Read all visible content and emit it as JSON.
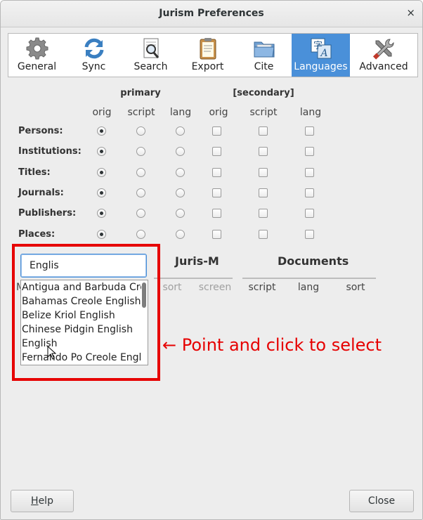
{
  "window": {
    "title": "Jurism Preferences",
    "close_glyph": "×"
  },
  "toolbar": {
    "tabs": [
      {
        "label": "General",
        "icon": "gear-icon",
        "selected": false
      },
      {
        "label": "Sync",
        "icon": "sync-icon",
        "selected": false
      },
      {
        "label": "Search",
        "icon": "search-icon",
        "selected": false
      },
      {
        "label": "Export",
        "icon": "clipboard-icon",
        "selected": false
      },
      {
        "label": "Cite",
        "icon": "folder-icon",
        "selected": false
      },
      {
        "label": "Languages",
        "icon": "translate-icon",
        "selected": true
      },
      {
        "label": "Advanced",
        "icon": "tools-icon",
        "selected": false
      }
    ],
    "translate_glyph_top": "字",
    "translate_glyph_bottom": "A"
  },
  "matrix": {
    "primary_label": "primary",
    "secondary_label": "[secondary]",
    "primary_cols": [
      "orig",
      "script",
      "lang"
    ],
    "secondary_cols": [
      "orig",
      "script",
      "lang"
    ],
    "rows": [
      {
        "label": "Persons:",
        "selected_primary": "orig"
      },
      {
        "label": "Institutions:",
        "selected_primary": "orig"
      },
      {
        "label": "Titles:",
        "selected_primary": "orig"
      },
      {
        "label": "Journals:",
        "selected_primary": "orig"
      },
      {
        "label": "Publishers:",
        "selected_primary": "orig"
      },
      {
        "label": "Places:",
        "selected_primary": "orig"
      }
    ]
  },
  "lang_section": {
    "jurism_title": "Juris-M",
    "documents_title": "Documents",
    "jurism_cols": [
      "sort",
      "screen"
    ],
    "documents_cols": [
      "script",
      "lang",
      "sort"
    ],
    "hidden_left_initial": "M"
  },
  "search": {
    "value": "Englis",
    "suggestions": [
      "Antigua and Barbuda Creole English",
      "Bahamas Creole English",
      "Belize Kriol English",
      "Chinese Pidgin English",
      "English",
      "Fernando Po Creole English"
    ]
  },
  "annotation": {
    "text": "← Point and click to select",
    "color": "#e60000"
  },
  "buttons": {
    "help_mnemonic": "H",
    "help_rest": "elp",
    "close": "Close"
  },
  "colors": {
    "accent": "#4a90d9",
    "annotation_red": "#e60000"
  }
}
